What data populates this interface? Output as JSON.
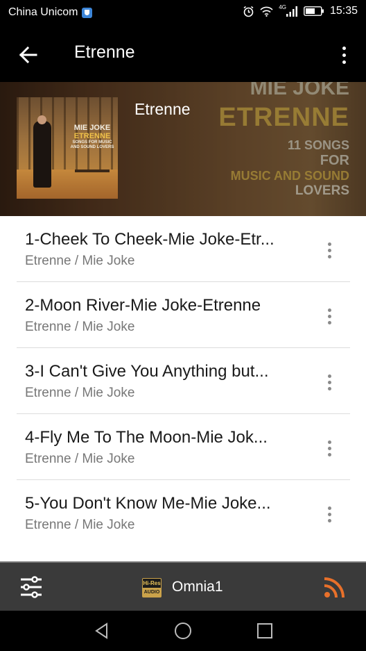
{
  "status_bar": {
    "carrier": "China Unicom",
    "network_label": "4G",
    "time": "15:35"
  },
  "app_bar": {
    "title": "Etrenne",
    "back_icon": "arrow-left-icon",
    "more_icon": "more-vertical-icon"
  },
  "album": {
    "title": "Etrenne",
    "cover_art": {
      "artist": "MIE JOKE",
      "album": "ETRENNE",
      "tagline": "SONGS FOR MUSIC AND SOUND LOVERS"
    },
    "background_art": {
      "line1": "MIE JOKE",
      "line2": "ETRENNE",
      "line3": "11 SONGS",
      "line4": "FOR",
      "line5": "MUSIC AND SOUND",
      "line6": "LOVERS"
    }
  },
  "tracks": [
    {
      "title": "1-Cheek To Cheek-Mie Joke-Etr...",
      "subtitle": "Etrenne / Mie Joke"
    },
    {
      "title": "2-Moon River-Mie Joke-Etrenne",
      "subtitle": "Etrenne / Mie Joke"
    },
    {
      "title": "3-I Can't Give You Anything but...",
      "subtitle": "Etrenne / Mie Joke"
    },
    {
      "title": "4-Fly Me To The Moon-Mie Jok...",
      "subtitle": "Etrenne / Mie Joke"
    },
    {
      "title": "5-You Don't Know Me-Mie Joke...",
      "subtitle": "Etrenne / Mie Joke"
    }
  ],
  "player_bar": {
    "device_name": "Omnia1",
    "hires_badge_top": "Hi-Res",
    "hires_badge_bottom": "AUDIO",
    "equalizer_icon": "equalizer-icon",
    "cast_icon": "cast-icon",
    "cast_color": "#e8702a"
  },
  "nav_bar": {
    "back_icon": "triangle-back-icon",
    "home_icon": "circle-home-icon",
    "recents_icon": "square-recents-icon"
  }
}
